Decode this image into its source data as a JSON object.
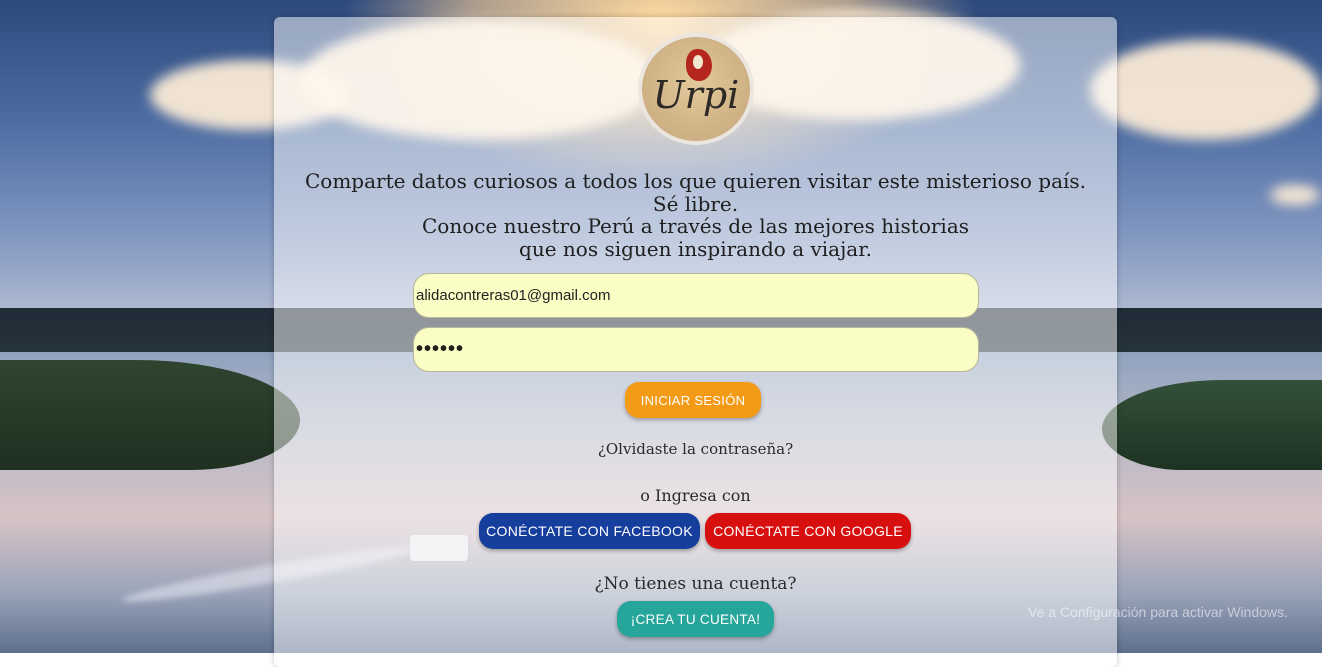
{
  "logo": {
    "text": "Urpi"
  },
  "tagline": {
    "line1": "Comparte datos curiosos a todos los que quieren visitar este misterioso país.",
    "line2": "Sé libre.",
    "line3": "Conoce nuestro Perú a través de las mejores historias",
    "line4": "que nos siguen inspirando a viajar."
  },
  "login_form": {
    "email_value": "alidacontreras01@gmail.com",
    "password_value": "••••••",
    "login_button": "INICIAR SESIÓN",
    "forgot_link": "¿Olvidaste la contraseña?"
  },
  "social": {
    "or_text": "o Ingresa con",
    "facebook_button": "CONÉCTATE CON FACEBOOK",
    "google_button": "CONÉCTATE CON GOOGLE"
  },
  "signup": {
    "prompt": "¿No tienes una cuenta?",
    "button": "¡CREA TU CUENTA!"
  },
  "watermark": {
    "text": "Ve a Configuración para activar Windows."
  },
  "colors": {
    "login": "#f39a16",
    "facebook": "#153e9d",
    "google": "#d80f0f",
    "create": "#26a59a",
    "input_bg": "#fafdc4"
  }
}
